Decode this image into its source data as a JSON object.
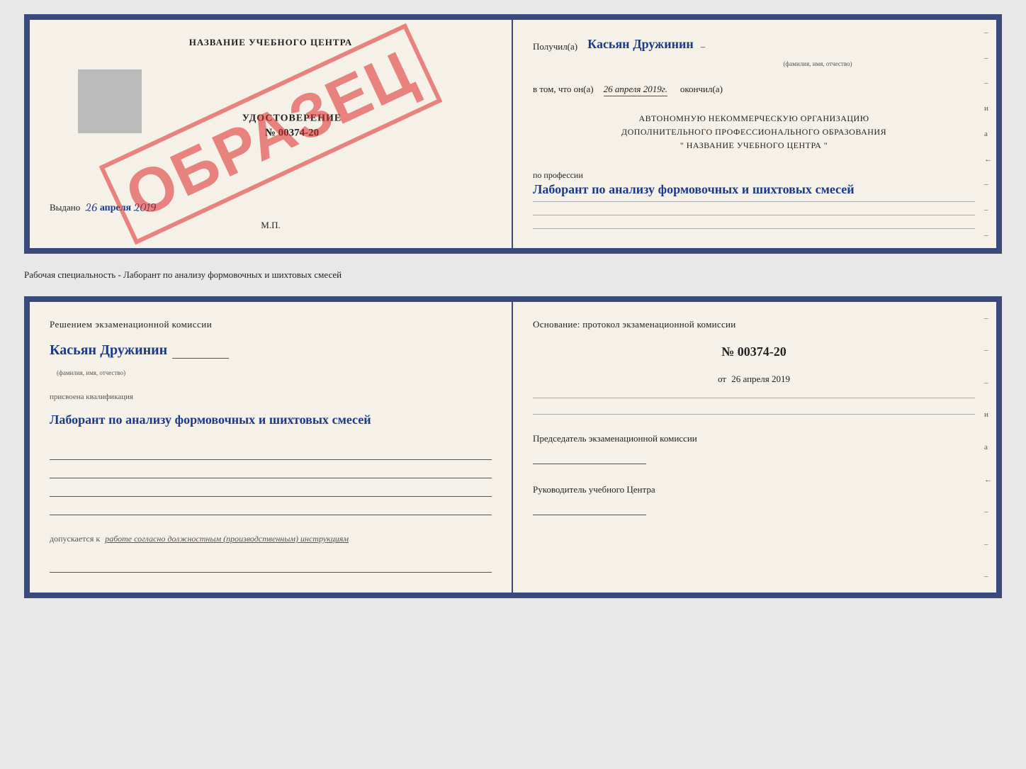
{
  "top_document": {
    "left": {
      "title": "НАЗВАНИЕ УЧЕБНОГО ЦЕНТРА",
      "grey_box_label": "",
      "udostoverenie_label": "УДОСТОВЕРЕНИЕ",
      "number": "№ 00374-20",
      "stamp": "ОБРАЗЕЦ",
      "vidano_label": "Выдано",
      "vidano_date": "26 апреля 2019",
      "mp_label": "М.П."
    },
    "right": {
      "poluchil_label": "Получил(а)",
      "poluchil_name": "Касьян Дружинин",
      "fio_hint": "(фамилия, имя, отчество)",
      "vtom_label": "в том, что он(а)",
      "vtom_date": "26 апреля 2019г.",
      "okonchil_label": "окончил(а)",
      "org_line1": "АВТОНОМНУЮ НЕКОММЕРЧЕСКУЮ ОРГАНИЗАЦИЮ",
      "org_line2": "ДОПОЛНИТЕЛЬНОГО ПРОФЕССИОНАЛЬНОГО ОБРАЗОВАНИЯ",
      "org_line3": "\"   НАЗВАНИЕ УЧЕБНОГО ЦЕНТРА   \"",
      "po_professii_label": "по профессии",
      "profession_handwritten": "Лаборант по анализу формовочных и шихтовых смесей",
      "side_labels": [
        "–",
        "–",
        "–",
        "и",
        "а",
        "←",
        "–",
        "–",
        "–"
      ]
    }
  },
  "separator": {
    "text": "Рабочая специальность - Лаборант по анализу формовочных и шихтовых смесей"
  },
  "bottom_document": {
    "left": {
      "resheniem_label": "Решением  экзаменационной  комиссии",
      "name_handwritten": "Касьян Дружинин",
      "fio_hint": "(фамилия, имя, отчество)",
      "prisvoena_label": "присвоена квалификация",
      "qualification_handwritten": "Лаборант по анализу формовочных и шихтовых смесей",
      "dopuskaetsya_label": "допускается к",
      "dopuskaetsya_text": "работе согласно должностным (производственным) инструкциям"
    },
    "right": {
      "osnovanie_label": "Основание: протокол экзаменационной  комиссии",
      "protocol_number": "№  00374-20",
      "ot_label": "от",
      "ot_date": "26 апреля 2019",
      "predsedatel_label": "Председатель экзаменационной комиссии",
      "rukovoditel_label": "Руководитель учебного Центра",
      "side_labels": [
        "–",
        "–",
        "–",
        "и",
        "а",
        "←",
        "–",
        "–",
        "–"
      ]
    }
  }
}
